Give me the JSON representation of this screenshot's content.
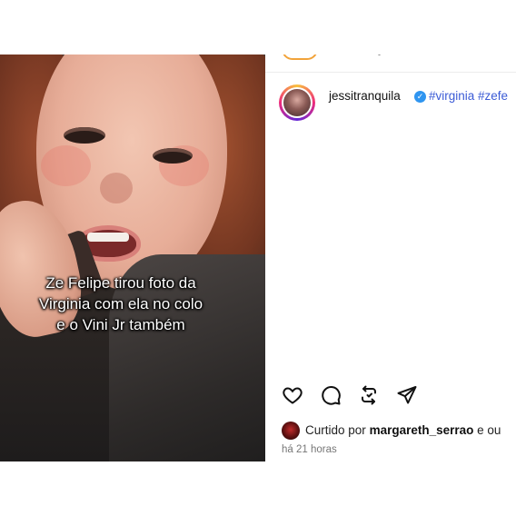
{
  "video": {
    "caption": "Ze Felipe tirou foto da Virginia com ela no colo e o Vini Jr também"
  },
  "post": {
    "username": "jessitranquila",
    "verified": true,
    "hashtags": "#virginia #zefe",
    "liked_prefix": "Curtido por",
    "liked_by": "margareth_serrao",
    "liked_suffix": "e ou",
    "timestamp": "há 21 horas"
  },
  "icons": {
    "like": "heart-icon",
    "comment": "comment-icon",
    "repost": "repost-icon",
    "share": "send-icon",
    "verified": "verified-badge-icon"
  },
  "colors": {
    "hashtag": "#3b5bd6",
    "verified": "#2f95f0",
    "story_ring": [
      "#f9c23c",
      "#ee2a7b",
      "#6228d7"
    ]
  }
}
